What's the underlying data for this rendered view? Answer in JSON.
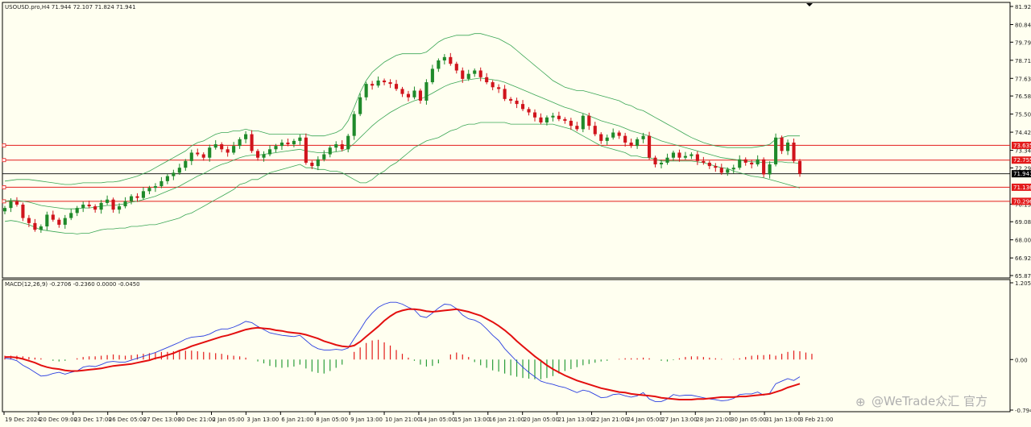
{
  "header": {
    "symbol_line": "USOUSD.pro,H4  71.944 72.107 71.824 71.941",
    "macd_line": "MACD(12,26,9) -0.2706 -0.2360 0.0000 -0.0450"
  },
  "watermark": {
    "text": "@WeTrade众汇 官方"
  },
  "colors": {
    "background": "#fffff0",
    "bull_candle": "#1f8a2a",
    "bear_candle": "#d0141c",
    "bollinger": "#3aa655",
    "level_line": "#e31b1b",
    "current_price_line": "#000000",
    "macd_line": "#2b3fe0",
    "signal_line": "#e30f0f",
    "hist_positive": "#e31b1b",
    "hist_negative": "#2a9d3a"
  },
  "chart_data": [
    {
      "type": "candlestick",
      "symbol": "USOUSD.pro",
      "timeframe": "H4",
      "ohlc_last": {
        "open": 71.944,
        "high": 72.107,
        "low": 71.824,
        "close": 71.941
      },
      "ylim": [
        65.87,
        81.92
      ],
      "y_ticks": [
        "81.920",
        "80.840",
        "79.790",
        "78.710",
        "77.630",
        "76.580",
        "75.500",
        "74.420",
        "73.340",
        "72.290",
        "70.130",
        "69.080",
        "68.000",
        "66.920",
        "65.870"
      ],
      "x_ticks": [
        "19 Dec 2024",
        "20 Dec 09:00",
        "23 Dec 17:00",
        "26 Dec 05:00",
        "27 Dec 13:00",
        "30 Dec 21:00",
        "2 Jan 05:00",
        "3 Jan 13:00",
        "6 Jan 21:00",
        "8 Jan 05:00",
        "9 Jan 13:00",
        "10 Jan 21:00",
        "14 Jan 05:00",
        "15 Jan 13:00",
        "16 Jan 21:00",
        "20 Jan 05:00",
        "21 Jan 13:00",
        "22 Jan 21:00",
        "24 Jan 05:00",
        "27 Jan 13:00",
        "28 Jan 21:00",
        "30 Jan 05:00",
        "31 Jan 13:00",
        "3 Feb 21:00"
      ],
      "levels": [
        {
          "label": "73.635",
          "value": 73.635
        },
        {
          "label": "72.755",
          "value": 72.755
        },
        {
          "label": "71.136",
          "value": 71.136
        },
        {
          "label": "70.296",
          "value": 70.296
        }
      ],
      "current_price": {
        "label": "71.941",
        "value": 71.941
      },
      "close": [
        69.9,
        70.3,
        70.1,
        69.3,
        69.0,
        68.6,
        68.8,
        69.5,
        69.2,
        68.9,
        69.3,
        69.6,
        69.9,
        70.1,
        70.0,
        69.8,
        70.2,
        70.4,
        69.8,
        70.0,
        70.3,
        70.6,
        70.5,
        70.9,
        71.1,
        71.2,
        71.5,
        71.8,
        72.0,
        72.3,
        72.7,
        73.2,
        73.1,
        72.9,
        73.5,
        73.7,
        73.4,
        73.2,
        73.6,
        74.0,
        74.3,
        73.3,
        72.9,
        73.1,
        73.4,
        73.6,
        73.8,
        73.7,
        73.9,
        74.1,
        72.6,
        72.4,
        72.8,
        73.1,
        73.5,
        73.7,
        73.4,
        74.2,
        75.5,
        76.5,
        77.3,
        77.2,
        77.5,
        77.4,
        77.3,
        77.0,
        76.7,
        76.5,
        76.9,
        76.3,
        77.4,
        78.2,
        78.7,
        78.9,
        78.5,
        78.1,
        77.6,
        77.9,
        78.1,
        77.7,
        77.4,
        77.1,
        77.0,
        76.4,
        76.3,
        76.1,
        75.8,
        75.6,
        75.3,
        75.0,
        75.3,
        75.4,
        75.2,
        75.1,
        74.8,
        74.6,
        75.4,
        74.8,
        74.3,
        73.9,
        74.1,
        74.4,
        74.2,
        73.8,
        73.6,
        74.0,
        74.2,
        72.9,
        72.5,
        72.6,
        72.9,
        73.2,
        72.9,
        73.0,
        73.1,
        72.7,
        72.6,
        72.4,
        72.3,
        72.0,
        72.2,
        72.3,
        72.8,
        72.6,
        72.5,
        72.8,
        71.9,
        72.5,
        74.1,
        73.3,
        73.8,
        72.7,
        71.941
      ],
      "bollinger": {
        "upper": [
          71.5,
          71.55,
          71.6,
          71.6,
          71.6,
          71.55,
          71.5,
          71.45,
          71.4,
          71.35,
          71.3,
          71.3,
          71.35,
          71.4,
          71.4,
          71.4,
          71.4,
          71.45,
          71.45,
          71.5,
          71.6,
          71.7,
          71.8,
          71.95,
          72.1,
          72.3,
          72.5,
          72.7,
          72.9,
          73.1,
          73.3,
          73.6,
          73.8,
          73.9,
          74.1,
          74.3,
          74.4,
          74.4,
          74.5,
          74.5,
          74.6,
          74.5,
          74.5,
          74.4,
          74.3,
          74.3,
          74.3,
          74.3,
          74.3,
          74.3,
          74.3,
          74.2,
          74.2,
          74.2,
          74.3,
          74.4,
          74.6,
          75.1,
          75.9,
          76.8,
          77.5,
          78.0,
          78.3,
          78.6,
          78.8,
          79.0,
          79.1,
          79.1,
          79.1,
          79.1,
          79.2,
          79.5,
          79.8,
          80.0,
          80.1,
          80.2,
          80.2,
          80.2,
          80.3,
          80.3,
          80.2,
          80.1,
          80.0,
          79.8,
          79.6,
          79.3,
          79.0,
          78.7,
          78.4,
          78.1,
          77.8,
          77.5,
          77.3,
          77.1,
          77.0,
          76.9,
          76.9,
          76.8,
          76.7,
          76.6,
          76.5,
          76.4,
          76.3,
          76.1,
          76.0,
          75.8,
          75.7,
          75.5,
          75.3,
          75.1,
          74.9,
          74.7,
          74.5,
          74.3,
          74.1,
          73.95,
          73.8,
          73.7,
          73.6,
          73.55,
          73.5,
          73.5,
          73.5,
          73.5,
          73.5,
          73.55,
          73.6,
          73.7,
          74.0,
          74.1,
          74.2,
          74.2,
          74.2
        ],
        "middle": [
          70.3,
          70.35,
          70.35,
          70.3,
          70.25,
          70.15,
          70.05,
          70.0,
          69.95,
          69.9,
          69.85,
          69.85,
          69.85,
          69.9,
          69.9,
          69.95,
          70.0,
          70.05,
          70.05,
          70.1,
          70.15,
          70.25,
          70.3,
          70.4,
          70.5,
          70.6,
          70.75,
          70.9,
          71.05,
          71.2,
          71.4,
          71.6,
          71.8,
          71.95,
          72.15,
          72.35,
          72.5,
          72.6,
          72.75,
          72.9,
          73.0,
          73.05,
          73.05,
          73.1,
          73.15,
          73.2,
          73.25,
          73.3,
          73.35,
          73.4,
          73.3,
          73.25,
          73.2,
          73.2,
          73.2,
          73.25,
          73.3,
          73.45,
          73.75,
          74.1,
          74.45,
          74.8,
          75.1,
          75.35,
          75.6,
          75.8,
          76.0,
          76.15,
          76.3,
          76.4,
          76.55,
          76.75,
          76.95,
          77.15,
          77.3,
          77.4,
          77.5,
          77.55,
          77.6,
          77.65,
          77.6,
          77.55,
          77.5,
          77.4,
          77.25,
          77.1,
          76.95,
          76.8,
          76.65,
          76.5,
          76.35,
          76.2,
          76.05,
          75.9,
          75.8,
          75.65,
          75.55,
          75.4,
          75.25,
          75.1,
          75.0,
          74.9,
          74.8,
          74.65,
          74.5,
          74.4,
          74.3,
          74.2,
          74.05,
          73.9,
          73.8,
          73.7,
          73.6,
          73.5,
          73.4,
          73.3,
          73.2,
          73.1,
          73.0,
          72.9,
          72.85,
          72.8,
          72.75,
          72.7,
          72.65,
          72.65,
          72.6,
          72.6,
          72.65,
          72.65,
          72.6,
          72.6,
          72.55
        ],
        "lower": [
          69.1,
          69.15,
          69.1,
          69.0,
          68.9,
          68.75,
          68.6,
          68.55,
          68.5,
          68.45,
          68.4,
          68.4,
          68.35,
          68.4,
          68.4,
          68.5,
          68.6,
          68.65,
          68.65,
          68.7,
          68.7,
          68.8,
          68.8,
          68.85,
          68.9,
          68.9,
          69.0,
          69.1,
          69.2,
          69.3,
          69.5,
          69.6,
          69.8,
          70.0,
          70.2,
          70.4,
          70.6,
          70.8,
          71.0,
          71.3,
          71.4,
          71.6,
          71.6,
          71.8,
          72.0,
          72.1,
          72.2,
          72.3,
          72.4,
          72.5,
          72.3,
          72.3,
          72.2,
          72.2,
          72.1,
          72.1,
          72.0,
          71.8,
          71.6,
          71.4,
          71.4,
          71.6,
          71.9,
          72.1,
          72.4,
          72.6,
          72.9,
          73.2,
          73.5,
          73.7,
          73.9,
          74.0,
          74.1,
          74.3,
          74.5,
          74.6,
          74.8,
          74.9,
          74.9,
          75.0,
          75.0,
          75.0,
          75.0,
          75.0,
          74.9,
          74.9,
          74.9,
          74.9,
          74.9,
          74.9,
          74.9,
          74.9,
          74.8,
          74.7,
          74.6,
          74.4,
          74.2,
          74.0,
          73.8,
          73.6,
          73.5,
          73.4,
          73.3,
          73.2,
          73.0,
          73.0,
          72.9,
          72.9,
          72.8,
          72.7,
          72.7,
          72.7,
          72.7,
          72.7,
          72.7,
          72.65,
          72.6,
          72.5,
          72.4,
          72.3,
          72.25,
          72.1,
          72.0,
          71.9,
          71.8,
          71.75,
          71.7,
          71.6,
          71.5,
          71.4,
          71.3,
          71.2,
          71.1
        ]
      }
    },
    {
      "type": "macd",
      "label": "MACD(12,26,9)",
      "ylim": [
        -0.7941,
        1.2058
      ],
      "y_ticks": [
        "1.2058",
        "0.00",
        "-0.7941"
      ],
      "macd": [
        0.02,
        0.01,
        -0.02,
        -0.09,
        -0.14,
        -0.2,
        -0.26,
        -0.25,
        -0.22,
        -0.2,
        -0.23,
        -0.2,
        -0.18,
        -0.12,
        -0.1,
        -0.11,
        -0.08,
        -0.04,
        -0.03,
        -0.04,
        -0.04,
        -0.01,
        0.02,
        0.05,
        0.08,
        0.11,
        0.15,
        0.19,
        0.23,
        0.27,
        0.32,
        0.35,
        0.36,
        0.37,
        0.4,
        0.45,
        0.48,
        0.48,
        0.51,
        0.55,
        0.6,
        0.58,
        0.52,
        0.47,
        0.42,
        0.4,
        0.38,
        0.37,
        0.36,
        0.38,
        0.3,
        0.22,
        0.17,
        0.15,
        0.15,
        0.16,
        0.15,
        0.18,
        0.33,
        0.47,
        0.62,
        0.73,
        0.82,
        0.87,
        0.9,
        0.9,
        0.87,
        0.82,
        0.78,
        0.68,
        0.66,
        0.73,
        0.81,
        0.87,
        0.86,
        0.8,
        0.7,
        0.64,
        0.62,
        0.57,
        0.48,
        0.38,
        0.3,
        0.17,
        0.07,
        -0.03,
        -0.12,
        -0.2,
        -0.27,
        -0.34,
        -0.37,
        -0.39,
        -0.42,
        -0.44,
        -0.48,
        -0.52,
        -0.48,
        -0.5,
        -0.55,
        -0.6,
        -0.59,
        -0.55,
        -0.54,
        -0.57,
        -0.59,
        -0.57,
        -0.52,
        -0.62,
        -0.66,
        -0.66,
        -0.62,
        -0.55,
        -0.57,
        -0.56,
        -0.56,
        -0.58,
        -0.6,
        -0.62,
        -0.63,
        -0.65,
        -0.64,
        -0.61,
        -0.55,
        -0.54,
        -0.54,
        -0.51,
        -0.56,
        -0.53,
        -0.38,
        -0.34,
        -0.3,
        -0.33,
        -0.27
      ],
      "signal": [
        0.04,
        0.04,
        0.03,
        0.01,
        -0.02,
        -0.05,
        -0.09,
        -0.12,
        -0.14,
        -0.15,
        -0.17,
        -0.18,
        -0.18,
        -0.17,
        -0.16,
        -0.15,
        -0.14,
        -0.12,
        -0.1,
        -0.09,
        -0.08,
        -0.07,
        -0.05,
        -0.03,
        -0.01,
        0.02,
        0.04,
        0.07,
        0.1,
        0.14,
        0.17,
        0.21,
        0.24,
        0.27,
        0.3,
        0.33,
        0.36,
        0.38,
        0.41,
        0.44,
        0.47,
        0.49,
        0.5,
        0.49,
        0.48,
        0.46,
        0.45,
        0.43,
        0.42,
        0.41,
        0.39,
        0.36,
        0.33,
        0.29,
        0.26,
        0.23,
        0.21,
        0.2,
        0.22,
        0.28,
        0.36,
        0.44,
        0.52,
        0.61,
        0.68,
        0.74,
        0.77,
        0.79,
        0.79,
        0.78,
        0.76,
        0.75,
        0.76,
        0.77,
        0.78,
        0.79,
        0.77,
        0.75,
        0.72,
        0.69,
        0.64,
        0.59,
        0.53,
        0.46,
        0.38,
        0.29,
        0.21,
        0.13,
        0.05,
        -0.02,
        -0.09,
        -0.15,
        -0.2,
        -0.25,
        -0.29,
        -0.33,
        -0.36,
        -0.39,
        -0.42,
        -0.45,
        -0.47,
        -0.49,
        -0.51,
        -0.52,
        -0.54,
        -0.55,
        -0.56,
        -0.57,
        -0.58,
        -0.6,
        -0.61,
        -0.62,
        -0.63,
        -0.63,
        -0.63,
        -0.62,
        -0.62,
        -0.61,
        -0.6,
        -0.59,
        -0.59,
        -0.59,
        -0.58,
        -0.58,
        -0.57,
        -0.56,
        -0.55,
        -0.54,
        -0.51,
        -0.48,
        -0.44,
        -0.41,
        -0.38
      ],
      "histogram": [
        0.06,
        0.06,
        0.06,
        0.05,
        0.04,
        0.03,
        0.02,
        0.0,
        -0.02,
        -0.03,
        -0.02,
        0.0,
        0.02,
        0.04,
        0.05,
        0.05,
        0.06,
        0.07,
        0.08,
        0.07,
        0.06,
        0.07,
        0.08,
        0.09,
        0.1,
        0.11,
        0.12,
        0.12,
        0.13,
        0.13,
        0.14,
        0.14,
        0.13,
        0.12,
        0.11,
        0.1,
        0.09,
        0.07,
        0.06,
        0.05,
        0.03,
        0.0,
        -0.03,
        -0.06,
        -0.1,
        -0.12,
        -0.13,
        -0.12,
        -0.11,
        -0.08,
        -0.14,
        -0.19,
        -0.21,
        -0.22,
        -0.18,
        -0.13,
        -0.08,
        0.0,
        0.12,
        0.19,
        0.26,
        0.3,
        0.31,
        0.27,
        0.22,
        0.15,
        0.09,
        0.03,
        -0.02,
        -0.08,
        -0.11,
        -0.1,
        -0.06,
        0.0,
        0.08,
        0.11,
        0.08,
        0.04,
        -0.04,
        -0.09,
        -0.13,
        -0.17,
        -0.19,
        -0.22,
        -0.25,
        -0.27,
        -0.29,
        -0.3,
        -0.31,
        -0.31,
        -0.29,
        -0.26,
        -0.22,
        -0.18,
        -0.15,
        -0.12,
        -0.09,
        -0.07,
        -0.05,
        -0.03,
        -0.02,
        0.0,
        0.01,
        0.02,
        0.02,
        0.02,
        0.03,
        0.02,
        0.0,
        -0.02,
        -0.03,
        -0.01,
        0.02,
        0.04,
        0.05,
        0.05,
        0.04,
        0.03,
        0.02,
        0.01,
        0.0,
        0.01,
        0.02,
        0.04,
        0.06,
        0.07,
        0.07,
        0.08,
        0.06,
        0.09,
        0.12,
        0.14,
        0.13,
        0.11,
        0.09,
        0.0
      ]
    }
  ]
}
